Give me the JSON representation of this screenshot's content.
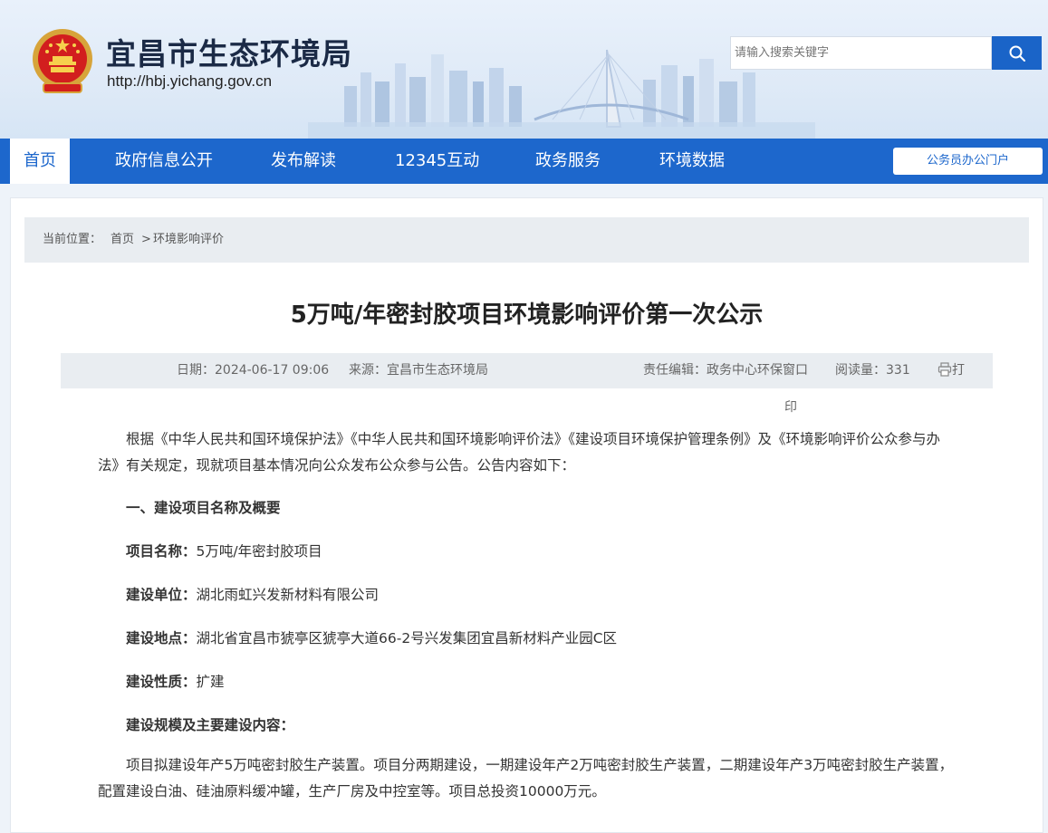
{
  "header": {
    "site_title": "宜昌市生态环境局",
    "site_url": "http://hbj.yichang.gov.cn",
    "search_placeholder": "请输入搜索关键字"
  },
  "nav": {
    "items": [
      {
        "label": "首页",
        "active": true
      },
      {
        "label": "政府信息公开"
      },
      {
        "label": "发布解读"
      },
      {
        "label": "12345互动"
      },
      {
        "label": "政务服务"
      },
      {
        "label": "环境数据"
      }
    ],
    "portal_button": "公务员办公门户"
  },
  "breadcrumb": {
    "prefix": "当前位置：",
    "home": "首页",
    "separator": ">",
    "current": "环境影响评价"
  },
  "article": {
    "title": "5万吨/年密封胶项目环境影响评价第一次公示",
    "meta": {
      "date": "日期：2024-06-17 09:06",
      "source": "来源：宜昌市生态环境局",
      "editor": "责任编辑：政务中心环保窗口",
      "views": "阅读量：331",
      "print_label_1": "打",
      "print_label_2": "印"
    },
    "intro": "根据《中华人民共和国环境保护法》《中华人民共和国环境影响评价法》《建设项目环境保护管理条例》及《环境影响评价公众参与办法》有关规定，现就项目基本情况向公众发布公众参与公告。公告内容如下：",
    "section1_heading": "一、建设项目名称及概要",
    "fields": [
      {
        "label": "项目名称：",
        "value": "5万吨/年密封胶项目"
      },
      {
        "label": "建设单位：",
        "value": "湖北雨虹兴发新材料有限公司"
      },
      {
        "label": "建设地点：",
        "value": "湖北省宜昌市猇亭区猇亭大道66-2号兴发集团宜昌新材料产业园C区"
      },
      {
        "label": "建设性质：",
        "value": "扩建"
      }
    ],
    "scale_heading": "建设规模及主要建设内容：",
    "scale_text": "项目拟建设年产5万吨密封胶生产装置。项目分两期建设，一期建设年产2万吨密封胶生产装置，二期建设年产3万吨密封胶生产装置，配置建设白油、硅油原料缓冲罐，生产厂房及中控室等。项目总投资10000万元。"
  }
}
